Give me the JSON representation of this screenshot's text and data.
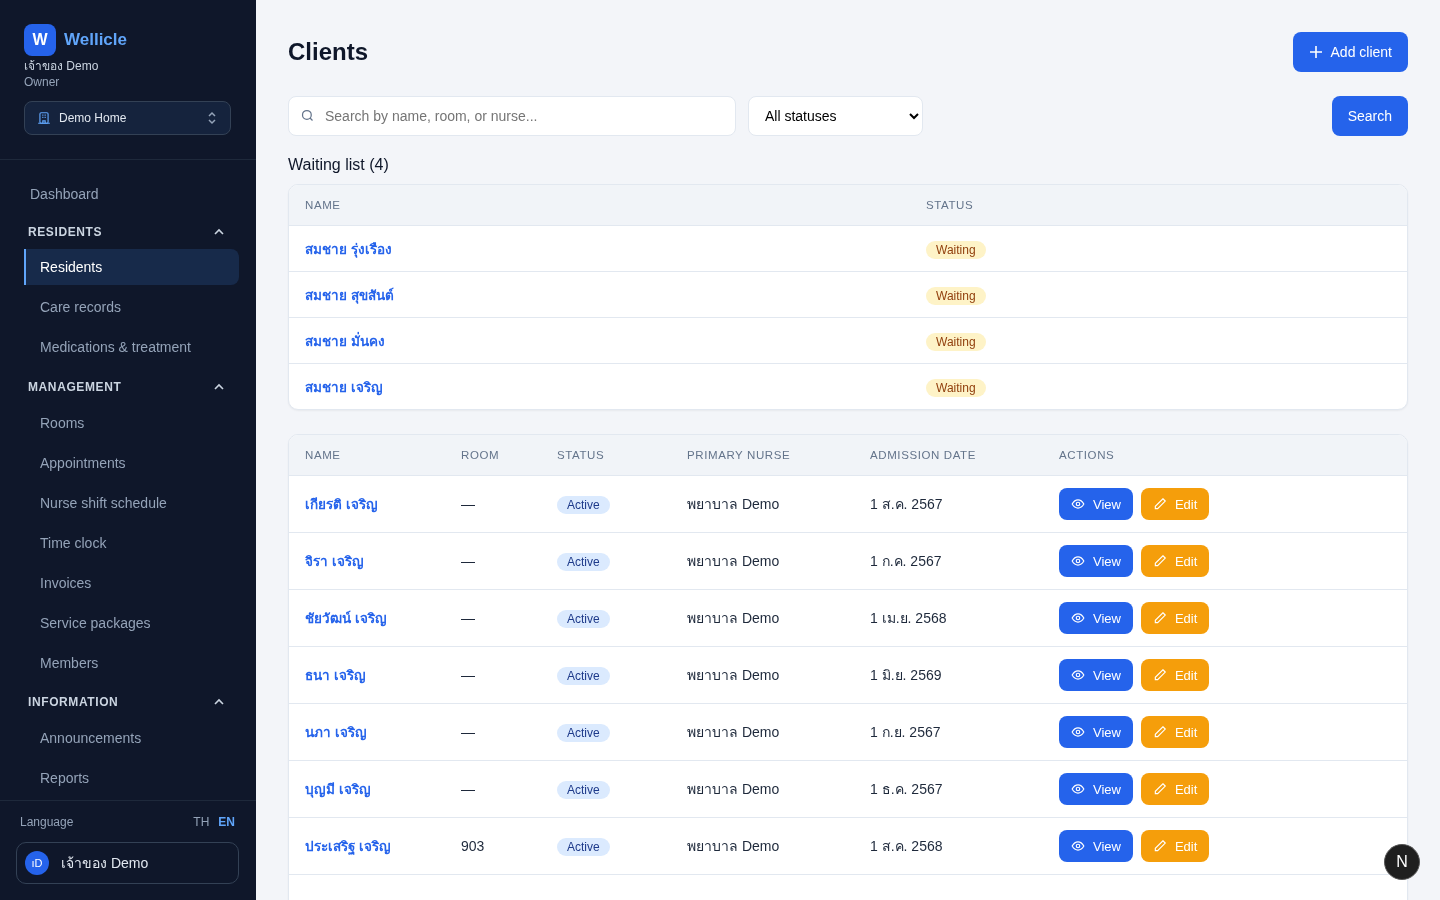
{
  "sidebar": {
    "logo": "W",
    "brand": "Wellicle",
    "user": "เจ้าของ Demo",
    "role": "Owner",
    "home_select": {
      "value": "Demo Home"
    },
    "nav": [
      {
        "kind": "link",
        "label": "Dashboard",
        "selected": false
      },
      {
        "kind": "section",
        "label": "RESIDENTS",
        "expanded": true,
        "items": [
          {
            "label": "Residents",
            "selected": true
          },
          {
            "label": "Care records",
            "selected": false
          },
          {
            "label": "Medications & treatment",
            "selected": false
          }
        ]
      },
      {
        "kind": "section",
        "label": "MANAGEMENT",
        "expanded": true,
        "items": [
          {
            "label": "Rooms",
            "selected": false
          },
          {
            "label": "Appointments",
            "selected": false
          },
          {
            "label": "Nurse shift schedule",
            "selected": false
          },
          {
            "label": "Time clock",
            "selected": false
          },
          {
            "label": "Invoices",
            "selected": false
          },
          {
            "label": "Service packages",
            "selected": false
          },
          {
            "label": "Members",
            "selected": false
          }
        ]
      },
      {
        "kind": "section",
        "label": "INFORMATION",
        "expanded": true,
        "items": [
          {
            "label": "Announcements",
            "selected": false
          },
          {
            "label": "Reports",
            "selected": false
          }
        ]
      }
    ],
    "language": {
      "label": "Language",
      "options": [
        {
          "label": "TH",
          "selected": false
        },
        {
          "label": "EN",
          "selected": true
        }
      ]
    },
    "account": {
      "initials": "ıD",
      "name": "เจ้าของ Demo"
    }
  },
  "page": {
    "title": "Clients",
    "add_button": "Add client",
    "search": {
      "placeholder": "Search by name, room, or nurse..."
    },
    "status_filter": {
      "value": "All statuses"
    },
    "search_button": "Search"
  },
  "waiting_list": {
    "title": "Waiting list (4)",
    "columns": [
      "NAME",
      "STATUS"
    ],
    "rows": [
      {
        "name": "สมชาย รุ่งเรือง",
        "status": "Waiting",
        "kind": "waiting"
      },
      {
        "name": "สมชาย สุขสันต์",
        "status": "Waiting",
        "kind": "waiting"
      },
      {
        "name": "สมชาย มั่นคง",
        "status": "Waiting",
        "kind": "waiting"
      },
      {
        "name": "สมชาย เจริญ",
        "status": "Waiting",
        "kind": "waiting"
      }
    ]
  },
  "clients": {
    "columns": [
      "NAME",
      "ROOM",
      "STATUS",
      "PRIMARY NURSE",
      "ADMISSION DATE",
      "ACTIONS"
    ],
    "rows": [
      {
        "name": "เกียรติ เจริญ",
        "room": "—",
        "status": "Active",
        "kind": "active",
        "nurse": "พยาบาล Demo",
        "admitted": "1 ส.ค. 2567",
        "view": "View",
        "edit": "Edit"
      },
      {
        "name": "จิรา เจริญ",
        "room": "—",
        "status": "Active",
        "kind": "active",
        "nurse": "พยาบาล Demo",
        "admitted": "1 ก.ค. 2567",
        "view": "View",
        "edit": "Edit"
      },
      {
        "name": "ชัยวัฒน์ เจริญ",
        "room": "—",
        "status": "Active",
        "kind": "active",
        "nurse": "พยาบาล Demo",
        "admitted": "1 เม.ย. 2568",
        "view": "View",
        "edit": "Edit"
      },
      {
        "name": "ธนา เจริญ",
        "room": "—",
        "status": "Active",
        "kind": "active",
        "nurse": "พยาบาล Demo",
        "admitted": "1 มิ.ย. 2569",
        "view": "View",
        "edit": "Edit"
      },
      {
        "name": "นภา เจริญ",
        "room": "—",
        "status": "Active",
        "kind": "active",
        "nurse": "พยาบาล Demo",
        "admitted": "1 ก.ย. 2567",
        "view": "View",
        "edit": "Edit"
      },
      {
        "name": "บุญมี เจริญ",
        "room": "—",
        "status": "Active",
        "kind": "active",
        "nurse": "พยาบาล Demo",
        "admitted": "1 ธ.ค. 2567",
        "view": "View",
        "edit": "Edit"
      },
      {
        "name": "ประเสริฐ เจริญ",
        "room": "903",
        "status": "Active",
        "kind": "active",
        "nurse": "พยาบาล Demo",
        "admitted": "1 ส.ค. 2568",
        "view": "View",
        "edit": "Edit"
      }
    ]
  },
  "dev_badge": {
    "label": "N"
  }
}
